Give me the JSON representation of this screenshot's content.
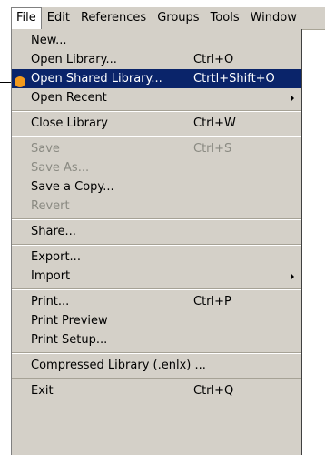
{
  "menubar": {
    "items": [
      "File",
      "Edit",
      "References",
      "Groups",
      "Tools",
      "Window"
    ]
  },
  "menu": {
    "groups": [
      {
        "items": [
          {
            "label": "New...",
            "shortcut": ""
          },
          {
            "label": "Open Library...",
            "shortcut": "Ctrl+O"
          },
          {
            "label": "Open Shared Library...",
            "shortcut": "Ctrtl+Shift+O"
          },
          {
            "label": "Open Recent",
            "shortcut": ""
          }
        ]
      },
      {
        "items": [
          {
            "label": "Close Library",
            "shortcut": "Ctrl+W"
          }
        ]
      },
      {
        "items": [
          {
            "label": "Save",
            "shortcut": "Ctrl+S"
          },
          {
            "label": "Save As...",
            "shortcut": ""
          },
          {
            "label": "Save a Copy...",
            "shortcut": ""
          },
          {
            "label": "Revert",
            "shortcut": ""
          }
        ]
      },
      {
        "items": [
          {
            "label": "Share...",
            "shortcut": ""
          }
        ]
      },
      {
        "items": [
          {
            "label": "Export...",
            "shortcut": ""
          },
          {
            "label": "Import",
            "shortcut": ""
          }
        ]
      },
      {
        "items": [
          {
            "label": "Print...",
            "shortcut": "Ctrl+P"
          },
          {
            "label": "Print Preview",
            "shortcut": ""
          },
          {
            "label": "Print Setup...",
            "shortcut": ""
          }
        ]
      },
      {
        "items": [
          {
            "label": "Compressed Library (.enlx) ...",
            "shortcut": ""
          }
        ]
      },
      {
        "items": [
          {
            "label": "Exit",
            "shortcut": "Ctrl+Q"
          }
        ]
      }
    ]
  },
  "colors": {
    "highlight": "#0a246a",
    "menu_bg": "#d4d0c8",
    "disabled_text": "#8a8a82",
    "callout": "#f39a1c"
  }
}
